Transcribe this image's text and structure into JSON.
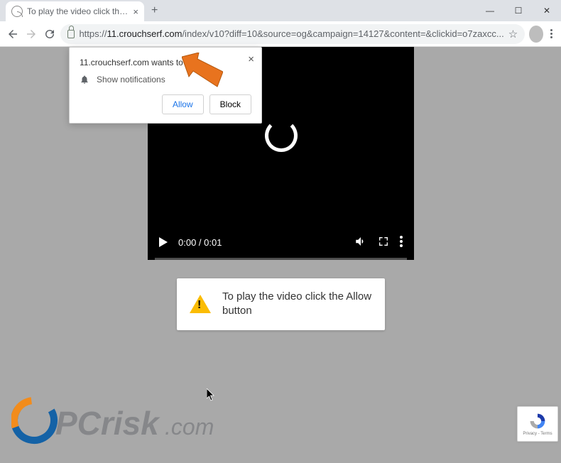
{
  "title_bar": {
    "tab_title": "To play the video click the Allow l",
    "tab_close": "×",
    "new_tab": "+"
  },
  "window_controls": {
    "minimize": "—",
    "maximize": "☐",
    "close": "✕"
  },
  "address_bar": {
    "url_scheme": "https://",
    "url_host": "11.crouchserf.com",
    "url_path": "/index/v10?diff=10&source=og&campaign=14127&content=&clickid=o7zaxcc...",
    "star": "☆"
  },
  "video": {
    "time": "0:00 / 0:01"
  },
  "message": {
    "text": "To play the video click the Allow button"
  },
  "prompt": {
    "header": "11.crouchserf.com wants to",
    "close": "×",
    "label": "Show notifications",
    "allow": "Allow",
    "block": "Block"
  },
  "recaptcha": {
    "text": "Privacy - Terms"
  },
  "watermark": {
    "text": "PCrisk.com"
  }
}
